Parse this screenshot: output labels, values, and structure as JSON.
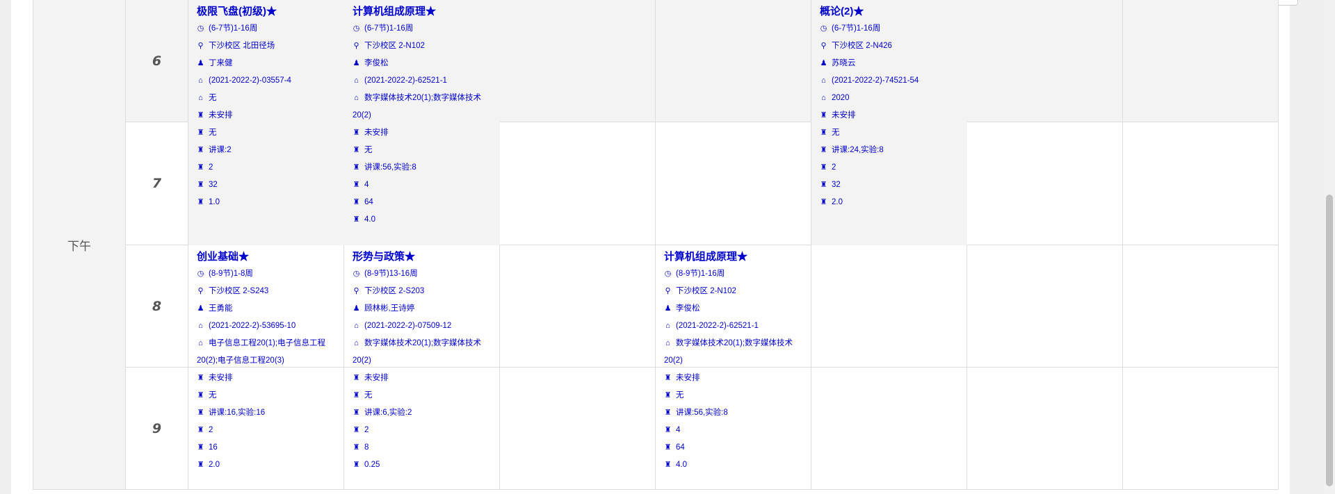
{
  "session_label": "下午",
  "periods": [
    "6",
    "7",
    "8",
    "9"
  ],
  "courses": [
    {
      "name": "极限飞盘(初级)",
      "marker": "★",
      "lines": [
        "(6-7节)1-16周",
        "下沙校区 北田径场",
        "丁来健",
        "(2021-2022-2)-03557-4",
        "无",
        "未安排",
        "无",
        "讲课:2",
        "2",
        "32",
        "1.0"
      ]
    },
    {
      "name": "计算机组成原理",
      "marker": "★",
      "lines": [
        "(6-7节)1-16周",
        "下沙校区 2-N102",
        "李俊松",
        "(2021-2022-2)-62521-1",
        "数字媒体技术20(1);数字媒体技术20(2)",
        "未安排",
        "无",
        "讲课:56,实验:8",
        "4",
        "64",
        "4.0"
      ]
    },
    {
      "name": "概论(2)",
      "marker": "★",
      "lines": [
        "(6-7节)1-16周",
        "下沙校区 2-N426",
        "苏晓云",
        "(2021-2022-2)-74521-54",
        "2020",
        "未安排",
        "无",
        "讲课:24,实验:8",
        "2",
        "32",
        "2.0"
      ]
    },
    {
      "name": "创业基础",
      "marker": "★",
      "lines": [
        "(8-9节)1-8周",
        "下沙校区 2-S243",
        "王勇能",
        "(2021-2022-2)-53695-10",
        "电子信息工程20(1);电子信息工程20(2);电子信息工程20(3)",
        "未安排",
        "无",
        "讲课:16,实验:16",
        "2",
        "16",
        "2.0"
      ]
    },
    {
      "name": "形势与政策",
      "marker": "★",
      "lines": [
        "(8-9节)13-16周",
        "下沙校区 2-S203",
        "顾林彬,王诗婷",
        "(2021-2022-2)-07509-12",
        "数字媒体技术20(1);数字媒体技术20(2)",
        "未安排",
        "无",
        "讲课:6,实验:2",
        "2",
        "8",
        "0.25"
      ]
    },
    {
      "name": "计算机组成原理",
      "marker": "★",
      "lines": [
        "(8-9节)1-16周",
        "下沙校区 2-N102",
        "李俊松",
        "(2021-2022-2)-62521-1",
        "数字媒体技术20(1);数字媒体技术20(2)",
        "未安排",
        "无",
        "讲课:56,实验:8",
        "4",
        "64",
        "4.0"
      ]
    }
  ],
  "icons": [
    "clock-icon",
    "map-marker-icon",
    "user-icon",
    "home-icon",
    "home-icon",
    "tower-icon",
    "tower-icon",
    "tower-icon",
    "tower-icon",
    "tower-icon",
    "tower-icon"
  ],
  "colors": {
    "course_text": "#0000cc",
    "shaded_cell": "#f3f3f3",
    "border": "#dddddd"
  }
}
